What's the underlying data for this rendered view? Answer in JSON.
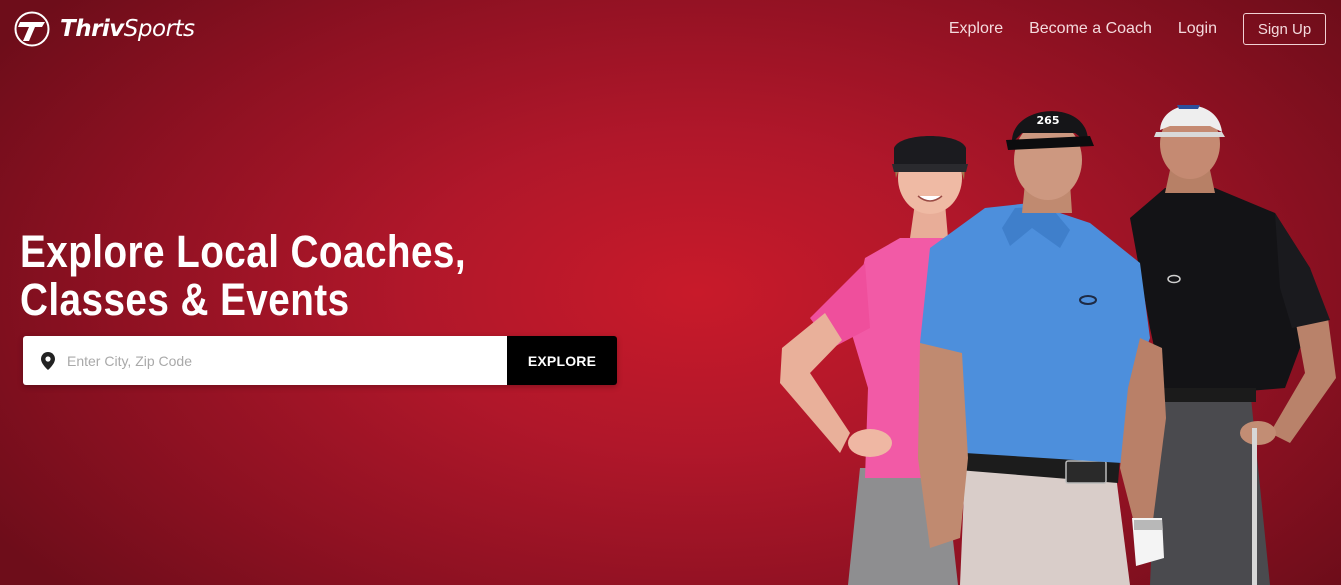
{
  "header": {
    "logo": {
      "word1": "Thriv",
      "word2": "Sports"
    },
    "nav": {
      "explore": "Explore",
      "become_coach": "Become a Coach",
      "login": "Login",
      "signup": "Sign Up"
    }
  },
  "hero": {
    "headline_line1": "Explore Local Coaches,",
    "headline_line2": "Classes & Events",
    "search": {
      "placeholder": "Enter City, Zip Code",
      "value": "",
      "button": "EXPLORE"
    },
    "cap_text": "265"
  },
  "colors": {
    "hero_red": "#b0172a",
    "hero_dark": "#6e0d1a",
    "button_black": "#000000"
  },
  "icons": {
    "logo": "thrivsports-logo-mark",
    "search": "map-pin-icon"
  }
}
